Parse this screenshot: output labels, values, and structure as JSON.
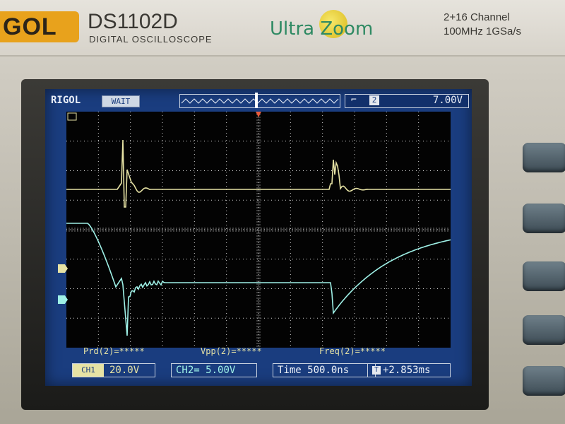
{
  "device": {
    "brand": "GOL",
    "model": "DS1102D",
    "model_sub": "DIGITAL OSCILLOSCOPE",
    "ultra_label": "Ultra Zoom",
    "spec_line1": "2+16 Channel",
    "spec_line2": "100MHz 1GSa/s"
  },
  "status": {
    "brand_label": "RIGOL",
    "run_state": "WAIT",
    "trigger_edge_icon": "rising-edge-icon",
    "trigger_source": "2",
    "trigger_level": "7.00V"
  },
  "measurements": {
    "prd": "Prd(2)=*****",
    "vpp": "Vpp(2)=*****",
    "freq": "Freq(2)=*****"
  },
  "bottom": {
    "ch1_tag": "CH1",
    "ch1_scale": "20.0V",
    "ch2_label": "CH2",
    "ch2_scale": "5.00V",
    "time_label": "Time",
    "time_scale": "500.0ns",
    "trig_pos_icon": "T",
    "trig_pos": "+2.853ms"
  },
  "colors": {
    "screen_bg": "#1a3d7f",
    "ch1_trace": "#e6e2a4",
    "ch2_trace": "#9ef0e6",
    "brand_orange": "#e8a21c",
    "ultra_green": "#2f8a63"
  }
}
